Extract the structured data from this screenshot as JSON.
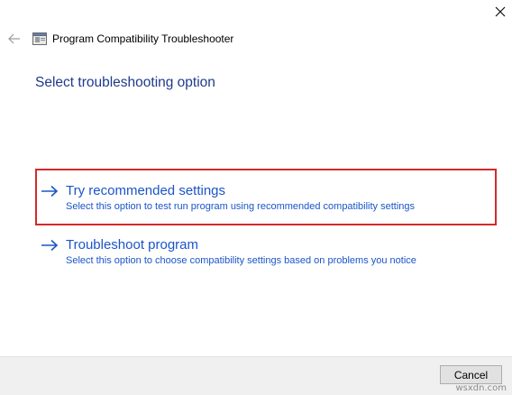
{
  "window": {
    "title": "Program Compatibility Troubleshooter",
    "back_icon": "back-arrow-icon",
    "app_icon": "program-compatibility-icon",
    "close_icon": "close-icon"
  },
  "main": {
    "heading": "Select troubleshooting option",
    "options": [
      {
        "title": "Try recommended settings",
        "description": "Select this option to test run program using recommended compatibility settings",
        "icon": "right-arrow-icon",
        "highlighted": true
      },
      {
        "title": "Troubleshoot program",
        "description": "Select this option to choose compatibility settings based on problems you notice",
        "icon": "right-arrow-icon",
        "highlighted": false
      }
    ]
  },
  "footer": {
    "cancel_label": "Cancel"
  },
  "watermark": "wsxdn.com",
  "colors": {
    "heading": "#1e3a8c",
    "link": "#1a55c8",
    "highlight_border": "#d42a2a",
    "footer_bg": "#f0f0f0"
  }
}
